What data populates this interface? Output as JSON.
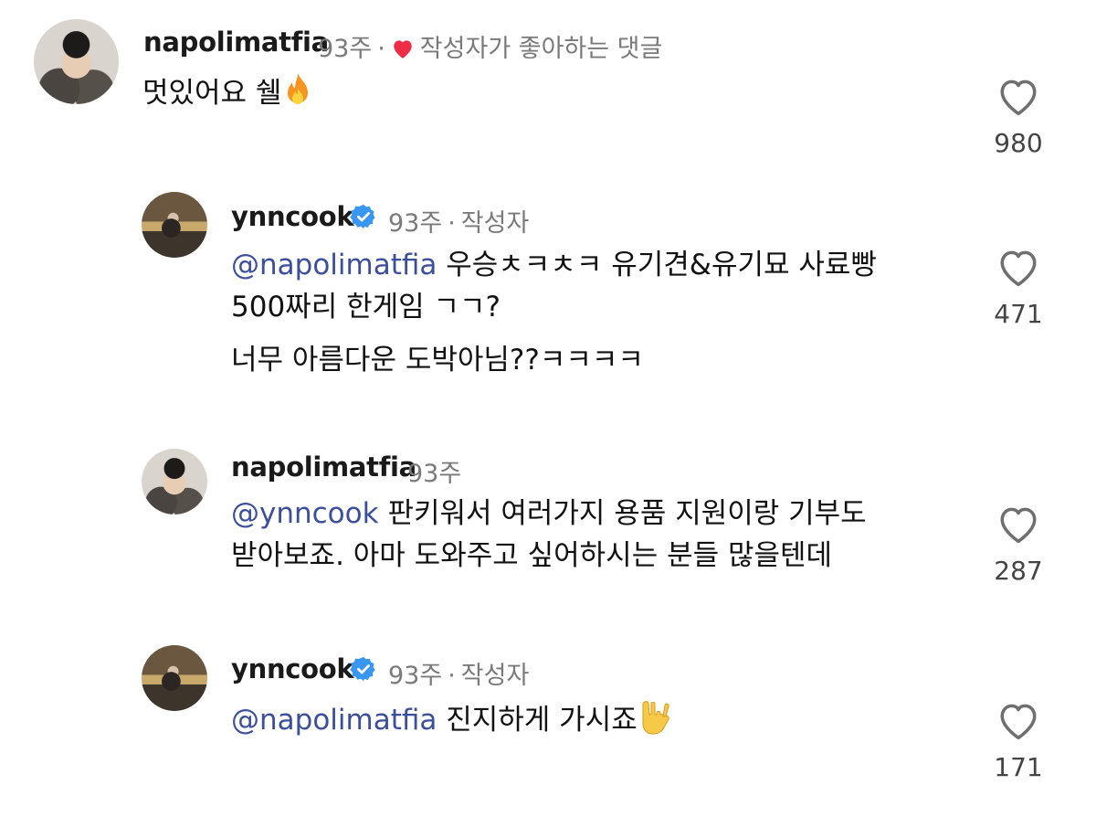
{
  "comments": [
    {
      "username": "napolimatfia",
      "time": "93주",
      "badge": "작성자가 좋아하는 댓글",
      "text": "멋있어요 쉘",
      "emoji": "fire-emoji",
      "likes": "980"
    },
    {
      "username": "ynncook",
      "verified": true,
      "time": "93주",
      "badge": "작성자",
      "mention": "@napolimatfia",
      "line1": "우승ㅊㅋㅊㅋ 유기견&유기묘 사료빵",
      "line2": "500짜리 한게임 ㄱㄱ?",
      "line3": "너무 아름다운 도박아님??ㅋㅋㅋㅋ",
      "likes": "471"
    },
    {
      "username": "napolimatfia",
      "time": "93주",
      "mention": "@ynncook",
      "line1": "판키워서 여러가지 용품 지원이랑 기부도",
      "line2": "받아보죠. 아마 도와주고 싶어하시는 분들 많을텐데",
      "likes": "287"
    },
    {
      "username": "ynncook",
      "verified": true,
      "time": "93주",
      "badge": "작성자",
      "mention": "@napolimatfia",
      "line1": "진지하게 가시죠",
      "emoji": "rock-hand-emoji",
      "likes": "171"
    }
  ],
  "colors": {
    "mention": "#3b4f9c",
    "verified": "#3897f0",
    "heart_red": "#ed2d48",
    "meta": "#7a7a7a"
  }
}
